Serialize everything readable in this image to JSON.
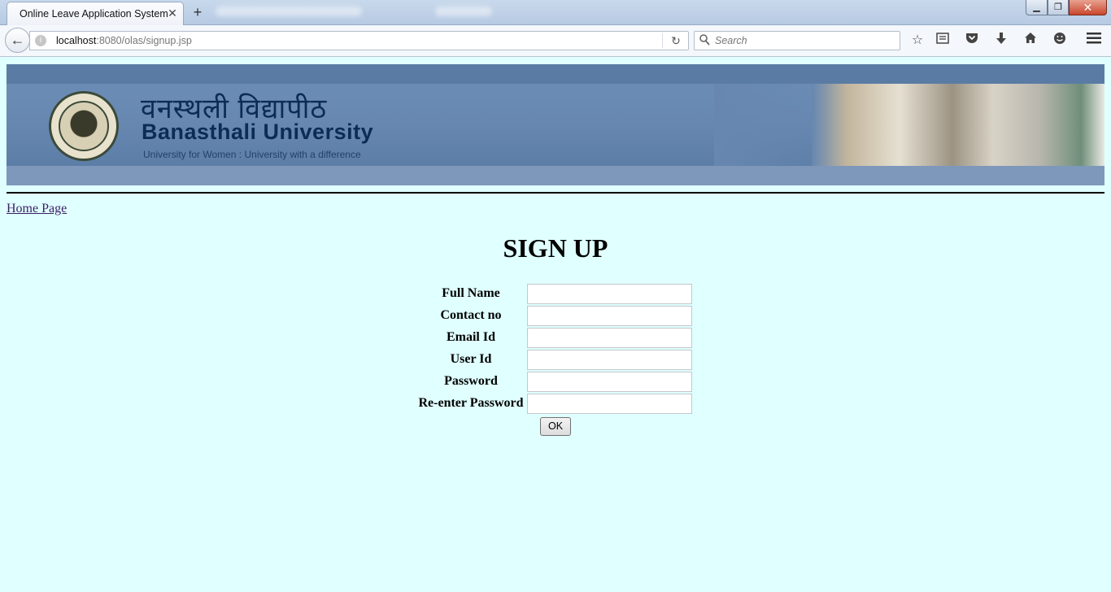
{
  "browser": {
    "tab_title": "Online Leave Application System",
    "tab_close_glyph": "✕",
    "new_tab_glyph": "+",
    "url_host": "localhost",
    "url_rest": ":8080/olas/signup.jsp",
    "search_placeholder": "Search",
    "window_buttons": {
      "minimize": "▁",
      "maximize": "❐",
      "close": "✕"
    },
    "toolbar_icons": [
      "bookmark-star-icon",
      "reading-list-icon",
      "pocket-icon",
      "downloads-icon",
      "home-icon",
      "chat-icon",
      "menu-icon"
    ]
  },
  "banner": {
    "hindi_title": "वनस्थली विद्यापीठ",
    "university_name": "Banasthali University",
    "tagline": "University for Women : University with a difference"
  },
  "page": {
    "home_link": "Home Page",
    "heading": "SIGN UP",
    "ok_button": "OK"
  },
  "form": {
    "fields": [
      {
        "label": "Full Name",
        "value": ""
      },
      {
        "label": "Contact no",
        "value": ""
      },
      {
        "label": "Email Id",
        "value": ""
      },
      {
        "label": "User Id",
        "value": ""
      },
      {
        "label": "Password",
        "value": ""
      },
      {
        "label": "Re-enter Password",
        "value": ""
      }
    ]
  },
  "colors": {
    "page_background": "#e0ffff",
    "banner_blue": "#6787b0",
    "banner_text": "#0d2c55",
    "link": "#3a1f63"
  }
}
